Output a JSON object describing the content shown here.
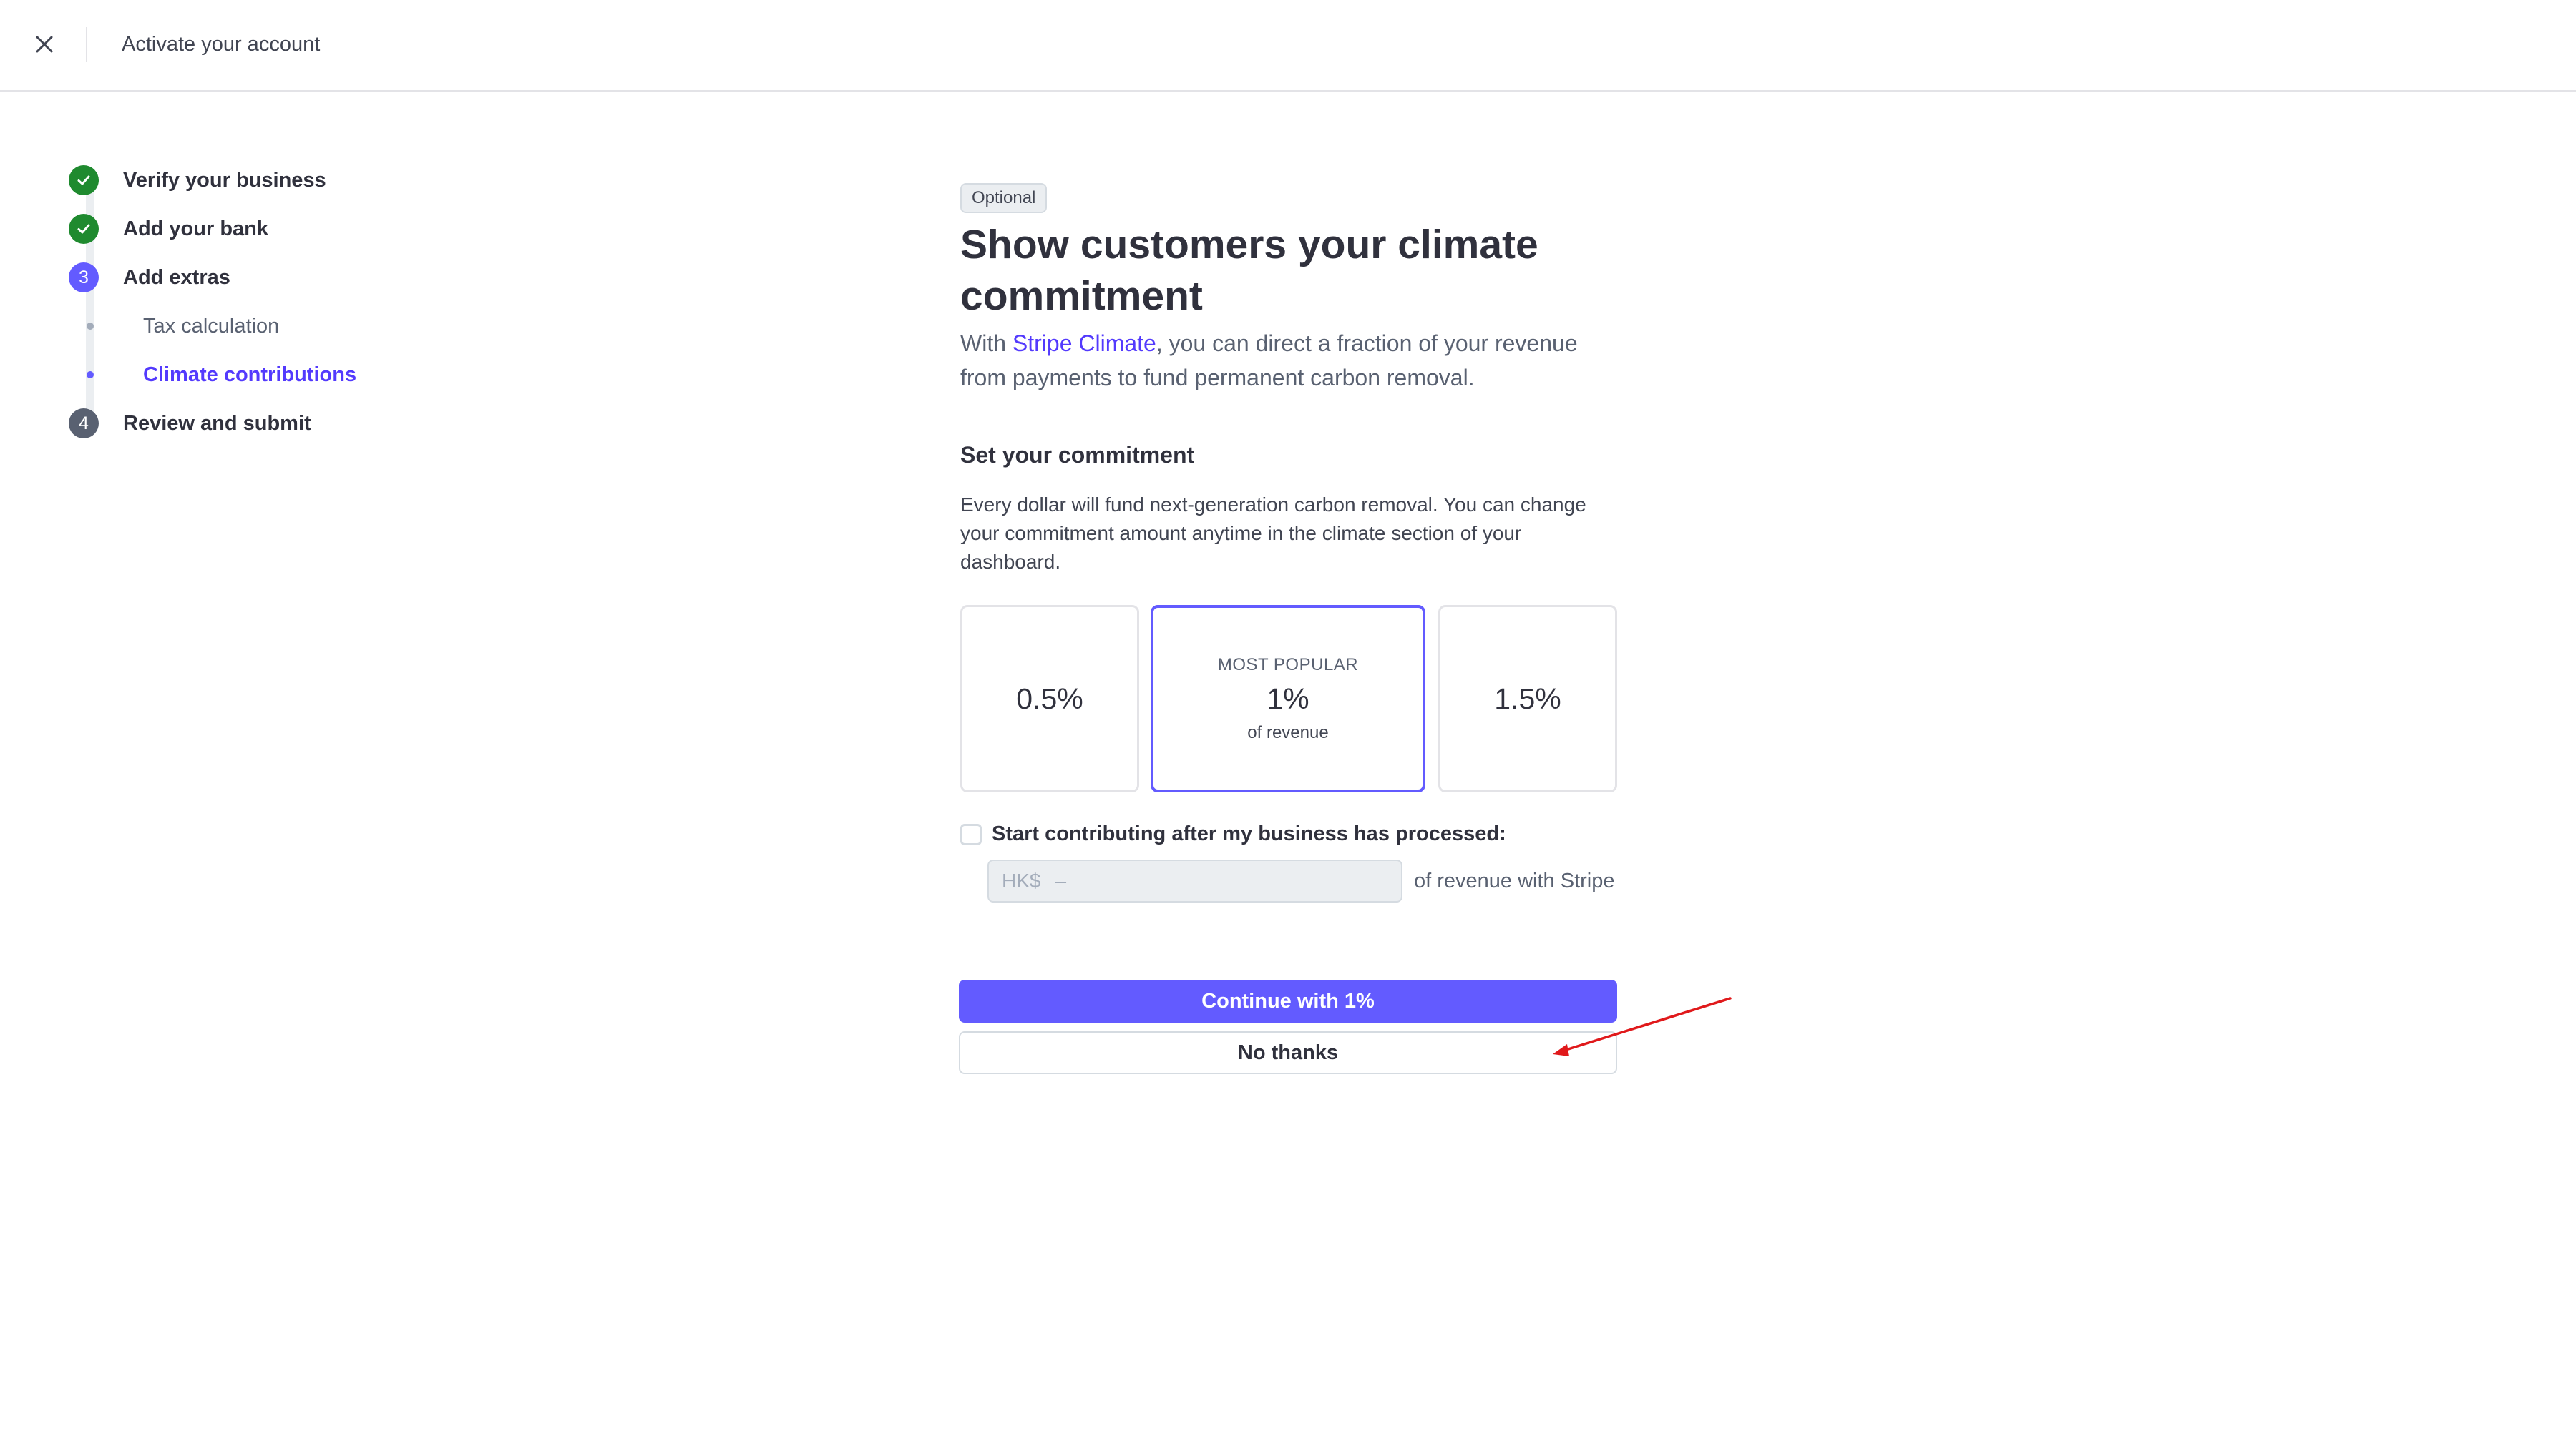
{
  "header": {
    "title": "Activate your account"
  },
  "steps": [
    {
      "label": "Verify your business",
      "state": "done",
      "icon": "check-icon"
    },
    {
      "label": "Add your bank",
      "state": "done",
      "icon": "check-icon"
    },
    {
      "label": "Add extras",
      "state": "active",
      "number": "3"
    },
    {
      "label": "Review and submit",
      "state": "pending",
      "number": "4"
    }
  ],
  "substeps": [
    {
      "label": "Tax calculation",
      "state": "inactive"
    },
    {
      "label": "Climate contributions",
      "state": "active"
    }
  ],
  "main": {
    "badge": "Optional",
    "headline": "Show customers your climate commitment",
    "intro_prefix": "With ",
    "intro_link": "Stripe Climate",
    "intro_suffix": ", you can direct a fraction of your revenue from payments to fund permanent carbon removal.",
    "section_title": "Set your commitment",
    "section_desc": "Every dollar will fund next-generation carbon removal. You can change your commitment amount anytime in the climate section of your dashboard.",
    "options": [
      {
        "value": "0.5%",
        "selected": false
      },
      {
        "eyebrow": "MOST POPULAR",
        "value": "1%",
        "sub": "of revenue",
        "selected": true
      },
      {
        "value": "1.5%",
        "selected": false
      }
    ],
    "checkbox_label": "Start contributing after my business has processed:",
    "checkbox_checked": false,
    "threshold_currency": "HK$",
    "threshold_value": "–",
    "threshold_suffix": "of revenue with Stripe",
    "primary_button": "Continue with 1%",
    "secondary_button": "No thanks"
  },
  "colors": {
    "accent": "#635bff",
    "link": "#533afd",
    "success": "#1f8a2f",
    "annotation_arrow": "#e0191b"
  }
}
